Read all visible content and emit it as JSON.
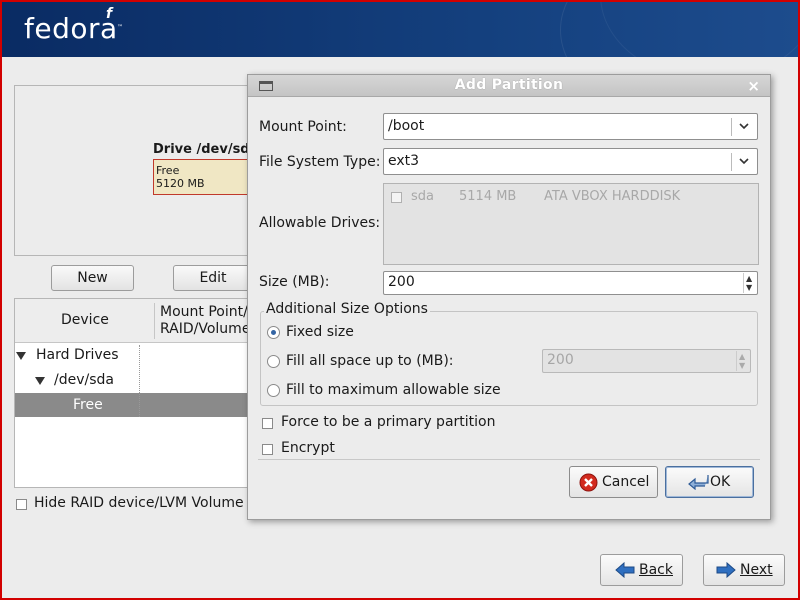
{
  "header": {
    "logo_text": "fedora",
    "logo_mark": "f",
    "logo_tm": "™"
  },
  "main": {
    "drive_title": "Drive /dev/sd",
    "free_label": "Free",
    "free_size": "5120 MB",
    "buttons": {
      "new_label": "New",
      "edit_label": "Edit"
    },
    "table": {
      "col_device": "Device",
      "col_mount_line1": "Mount Point/",
      "col_mount_line2": "RAID/Volume",
      "rows": [
        "Hard Drives",
        "/dev/sda",
        "Free"
      ]
    },
    "hide_raid_label": "Hide RAID device/LVM Volume G"
  },
  "nav": {
    "back_label": "Back",
    "next_label": "Next"
  },
  "dialog": {
    "title": "Add Partition",
    "close_glyph": "×",
    "mount_point_label": "Mount Point:",
    "mount_point_value": "/boot",
    "fs_type_label": "File System Type:",
    "fs_type_value": "ext3",
    "allowable_drives_label": "Allowable Drives:",
    "drives": [
      {
        "name": "sda",
        "size": "5114 MB",
        "model": "ATA VBOX HARDDISK",
        "checked": false
      }
    ],
    "size_label": "Size (MB):",
    "size_value": "200",
    "size_options_title": "Additional Size Options",
    "opt_fixed": "Fixed size",
    "opt_fill_upto": "Fill all space up to (MB):",
    "fill_upto_value": "200",
    "opt_fill_max": "Fill to maximum allowable size",
    "selected_option": "fixed",
    "force_primary_label": "Force to be a primary partition",
    "encrypt_label": "Encrypt",
    "cancel_label": "Cancel",
    "ok_label": "OK"
  },
  "colors": {
    "header": "#0a2b63",
    "selected_row": "#8a8a8a",
    "free_fill": "#f0e7c4",
    "frame": "#d20000"
  }
}
